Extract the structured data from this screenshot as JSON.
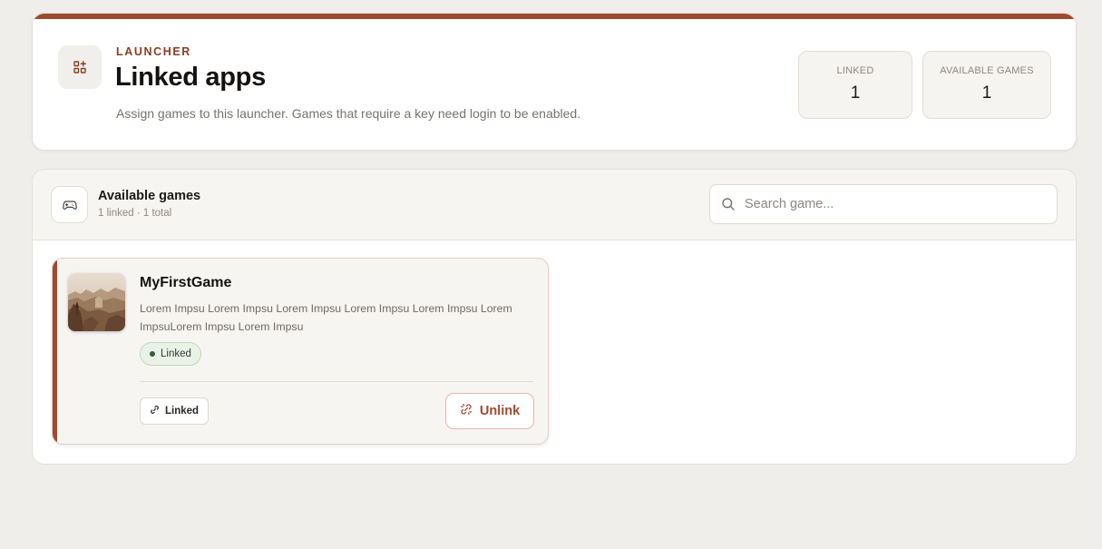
{
  "header": {
    "eyebrow": "LAUNCHER",
    "title": "Linked apps",
    "subtitle": "Assign games to this launcher. Games that require a key need login to be enabled.",
    "icon": "apps-add-icon",
    "stats": [
      {
        "label": "LINKED",
        "value": "1"
      },
      {
        "label": "AVAILABLE GAMES",
        "value": "1"
      }
    ]
  },
  "games_panel": {
    "icon": "gamepad-icon",
    "title": "Available games",
    "summary": "1 linked · 1 total",
    "search": {
      "placeholder": "Search game...",
      "value": "",
      "icon": "search-icon"
    }
  },
  "games": [
    {
      "title": "MyFirstGame",
      "description": "Lorem Impsu Lorem Impsu Lorem Impsu Lorem Impsu Lorem Impsu Lorem ImpsuLorem Impsu Lorem Impsu",
      "status_badge": "Linked",
      "linked_button": "Linked",
      "unlink_button": "Unlink",
      "thumbnail": "canyon-landscape-image"
    }
  ],
  "colors": {
    "accent": "#a0492e",
    "background": "#f0eeeb",
    "badge_bg": "#e9f2e6",
    "badge_border": "#bfd9b9"
  }
}
